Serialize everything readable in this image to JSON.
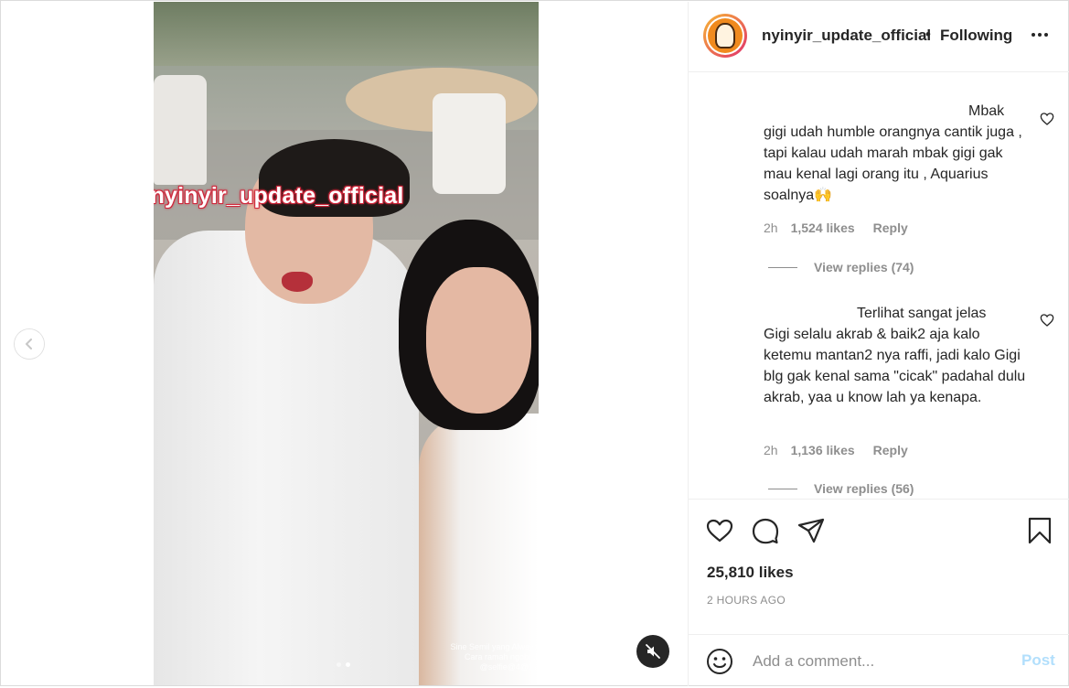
{
  "post": {
    "username": "nyinyir_update_official",
    "separator": "•",
    "follow_status": "Following",
    "watermark": "@nyinyir_update_official",
    "video_credits": [
      "Sine Semil yang Always",
      "Cara ramah ngobrol",
      "@selfie@4@17"
    ]
  },
  "comments": [
    {
      "text": "Mbak\ngigi udah humble orangnya cantik juga , tapi kalau udah marah mbak gigi gak mau kenal lagi orang itu , Aquarius soalnya🙌",
      "time": "2h",
      "likes": "1,524 likes",
      "reply_label": "Reply",
      "view_replies": "View replies (74)"
    },
    {
      "text": "Terlihat sangat jelas\nGigi selalu akrab & baik2 aja kalo ketemu mantan2 nya raffi, jadi kalo Gigi blg gak kenal sama \"cicak\" padahal dulu akrab, yaa u know lah ya kenapa.",
      "time": "2h",
      "likes": "1,136 likes",
      "reply_label": "Reply",
      "view_replies": "View replies (56)"
    }
  ],
  "actions": {
    "likes": "25,810 likes",
    "timestamp": "2 HOURS AGO"
  },
  "composer": {
    "placeholder": "Add a comment...",
    "post_label": "Post"
  },
  "icons": {
    "prev": "chevron-left-icon",
    "mute": "speaker-muted-icon",
    "more": "more-horizontal-icon",
    "like": "heart-icon",
    "comment": "comment-bubble-icon",
    "share": "paper-plane-icon",
    "save": "bookmark-icon",
    "emoji": "smiley-icon"
  },
  "colors": {
    "link_disabled": "#b2dffc",
    "secondary_text": "#8e8e8e",
    "primary_text": "#262626",
    "watermark_outline": "#d0283c"
  }
}
